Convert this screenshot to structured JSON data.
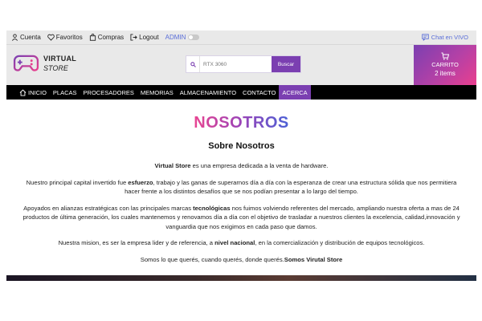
{
  "topbar": {
    "account": "Cuenta",
    "favorites": "Favoritos",
    "purchases": "Compras",
    "logout": "Logout",
    "admin": "ADMIN",
    "chat": "Chat en VIVO"
  },
  "header": {
    "logo_line1": "VIRTUAL",
    "logo_line2": "STORE",
    "search_placeholder": "RTX 3060",
    "search_button": "Buscar",
    "cart_label": "CARRITO",
    "cart_count": "2 items"
  },
  "nav": {
    "items": [
      {
        "label": "INICIO"
      },
      {
        "label": "PLACAS"
      },
      {
        "label": "PROCESADORES"
      },
      {
        "label": "MEMORIAS"
      },
      {
        "label": "ALMACENAMIENTO"
      },
      {
        "label": "CONTACTO"
      },
      {
        "label": "ACERCA"
      }
    ]
  },
  "main": {
    "title": "NOSOTROS",
    "subtitle": "Sobre Nosotros",
    "p1_bold": "Virtual Store",
    "p1_rest": " es una empresa dedicada a la venta de hardware.",
    "p2_a": "Nuestro principal capital invertido fue ",
    "p2_bold": "esfuerzo",
    "p2_b": ", trabajo y las ganas de superarnos día a día con la esperanza de crear una estructura sólida que nos permitiera hacer frente a los distintos desafíos que se nos podían presentar a lo largo del tiempo.",
    "p3_a": "Apoyados en alianzas estratégicas con las principales marcas ",
    "p3_bold": "tecnológicas",
    "p3_b": " nos fuimos volviendo referentes del mercado, ampliando nuestra oferta a mas de 24 productos de última generación, los cuales mantenemos y renovamos día a día con el objetivo de trasladar a nuestros clientes la excelencia, calidad,innovación y vanguardia que nos exigimos en cada paso que damos.",
    "p4_a": "Nuestra mision, es ser la empresa lider y de referencia, a ",
    "p4_bold": "nivel nacional",
    "p4_b": ", en la comercialización y distribución de equipos tecnológicos.",
    "p5_a": "Somos lo que querés, cuando querés, donde querés.",
    "p5_bold": "Somos Virutal Store"
  },
  "colors": {
    "accent": "#7b3fb1",
    "chat": "#5a6ed8",
    "title_gradient_start": "#e94592",
    "title_gradient_end": "#4a61d6"
  }
}
